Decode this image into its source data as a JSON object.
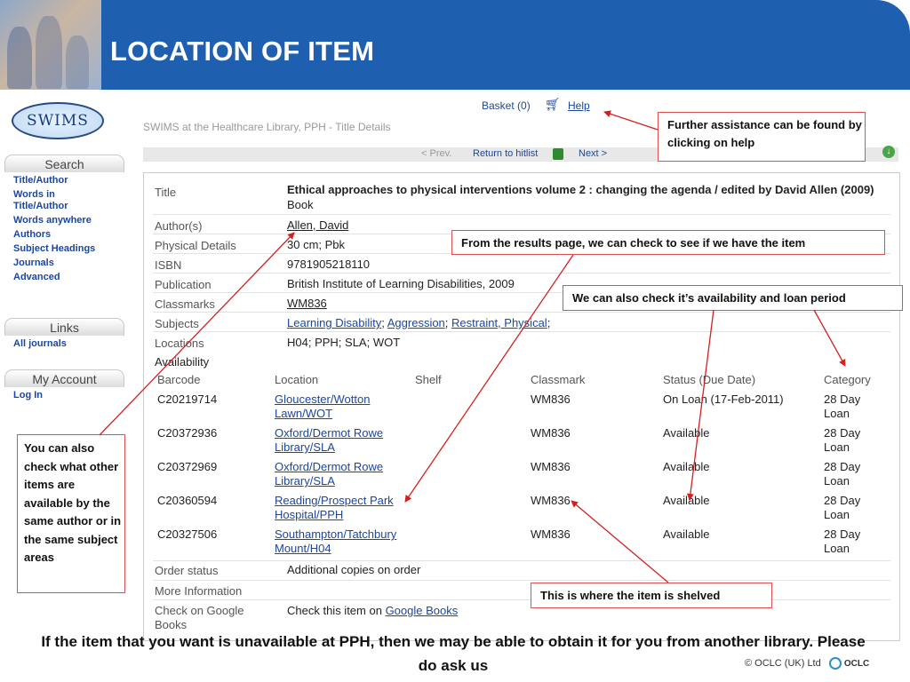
{
  "slide": {
    "title": "LOCATION OF ITEM",
    "footer": "If the item that you want is unavailable at PPH, then we may be able to obtain it for you from another library. Please do ask us",
    "copyright": "© OCLC (UK) Ltd",
    "oclc_logo": "OCLC"
  },
  "logo": {
    "text": "SWIMS"
  },
  "sidebar": {
    "search_heading": "Search",
    "search_items": [
      "Title/Author",
      "Words in Title/Author",
      "Words anywhere",
      "Authors",
      "Subject Headings",
      "Journals",
      "Advanced"
    ],
    "links_heading": "Links",
    "links_items": [
      "All journals"
    ],
    "account_heading": "My Account",
    "account_items": [
      "Log In"
    ]
  },
  "topbar": {
    "basket": "Basket (0)",
    "help": "Help",
    "subtitle": "SWIMS at the Healthcare Library, PPH - Title Details",
    "prev": "< Prev.",
    "return": "Return to hitlist",
    "next": "Next >"
  },
  "details": {
    "labels": {
      "title": "Title",
      "authors": "Author(s)",
      "physical": "Physical Details",
      "isbn": "ISBN",
      "publication": "Publication",
      "classmarks": "Classmarks",
      "subjects": "Subjects",
      "locations": "Locations",
      "availability": "Availability",
      "order_status": "Order status",
      "more_info": "More Information",
      "google": "Check on Google Books"
    },
    "title": "Ethical approaches to physical interventions volume 2 : changing the agenda / edited by David Allen (2009)",
    "title_type": "Book",
    "author": "Allen, David",
    "physical": "30 cm; Pbk",
    "isbn": "9781905218110",
    "publication": "British Institute of Learning Disabilities, 2009",
    "classmark": "WM836",
    "subjects": [
      "Learning Disability",
      "Aggression",
      "Restraint, Physical"
    ],
    "locations": "H04; PPH; SLA; WOT",
    "order_status": "Additional copies on order",
    "more_info": "",
    "google_prefix": "Check this item on",
    "google_link": "Google Books"
  },
  "holdings": {
    "headers": {
      "barcode": "Barcode",
      "location": "Location",
      "shelf": "Shelf",
      "classmark": "Classmark",
      "status": "Status (Due Date)",
      "category": "Category"
    },
    "rows": [
      {
        "barcode": "C20219714",
        "location": "Gloucester/Wotton Lawn/WOT",
        "shelf": "",
        "classmark": "WM836",
        "status": "On Loan (17-Feb-2011)",
        "category": "28 Day Loan"
      },
      {
        "barcode": "C20372936",
        "location": "Oxford/Dermot Rowe Library/SLA",
        "shelf": "",
        "classmark": "WM836",
        "status": "Available",
        "category": "28 Day Loan"
      },
      {
        "barcode": "C20372969",
        "location": "Oxford/Dermot Rowe Library/SLA",
        "shelf": "",
        "classmark": "WM836",
        "status": "Available",
        "category": "28 Day Loan"
      },
      {
        "barcode": "C20360594",
        "location": "Reading/Prospect Park Hospital/PPH",
        "shelf": "",
        "classmark": "WM836",
        "status": "Available",
        "category": "28 Day Loan"
      },
      {
        "barcode": "C20327506",
        "location": "Southampton/Tatchbury Mount/H04",
        "shelf": "",
        "classmark": "WM836",
        "status": "Available",
        "category": "28 Day Loan"
      }
    ]
  },
  "callouts": {
    "help": "Further assistance can be found by clicking on help",
    "results": "From the results page, we can check to see if we have the item",
    "availability": "We can also check it’s availability and loan period",
    "author": "You can also check what other items are available by the same author or in the same subject areas",
    "shelved": "This is where the item is shelved"
  },
  "colors": {
    "header_blue": "#1f5fb0",
    "link_blue": "#1a47a0",
    "arrow_red": "#d42020"
  }
}
